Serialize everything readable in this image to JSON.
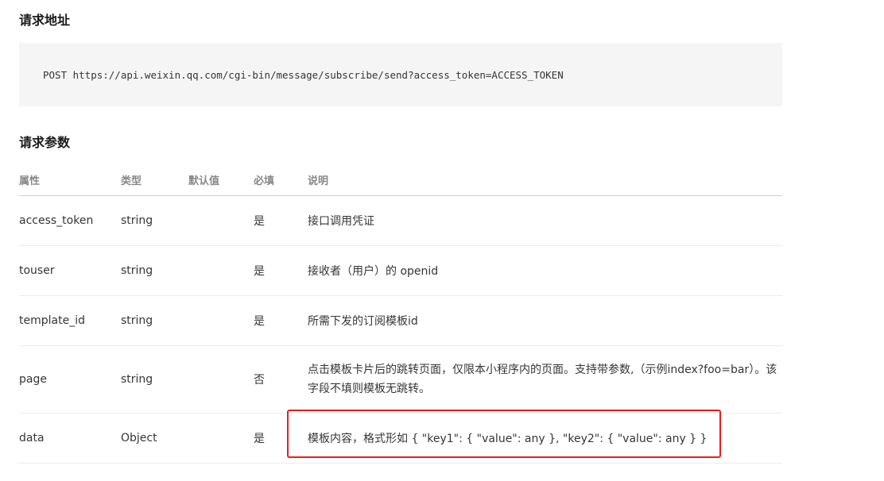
{
  "request_url": {
    "title": "请求地址",
    "code": "POST https://api.weixin.qq.com/cgi-bin/message/subscribe/send?access_token=ACCESS_TOKEN"
  },
  "request_params": {
    "title": "请求参数",
    "columns": {
      "name": "属性",
      "type": "类型",
      "default": "默认值",
      "required": "必填",
      "desc": "说明"
    },
    "rows": [
      {
        "name": "access_token",
        "type": "string",
        "default": "",
        "required": "是",
        "desc": "接口调用凭证"
      },
      {
        "name": "touser",
        "type": "string",
        "default": "",
        "required": "是",
        "desc": "接收者（用户）的 openid"
      },
      {
        "name": "template_id",
        "type": "string",
        "default": "",
        "required": "是",
        "desc": "所需下发的订阅模板id"
      },
      {
        "name": "page",
        "type": "string",
        "default": "",
        "required": "否",
        "desc": "点击模板卡片后的跳转页面，仅限本小程序内的页面。支持带参数,（示例index?foo=bar）。该字段不填则模板无跳转。"
      },
      {
        "name": "data",
        "type": "Object",
        "default": "",
        "required": "是",
        "desc": "模板内容，格式形如 { \"key1\": { \"value\": any }, \"key2\": { \"value\": any } }"
      }
    ]
  },
  "colors": {
    "link": "#576b95",
    "highlight": "#e61e1e",
    "code_bg": "#f5f5f5"
  }
}
